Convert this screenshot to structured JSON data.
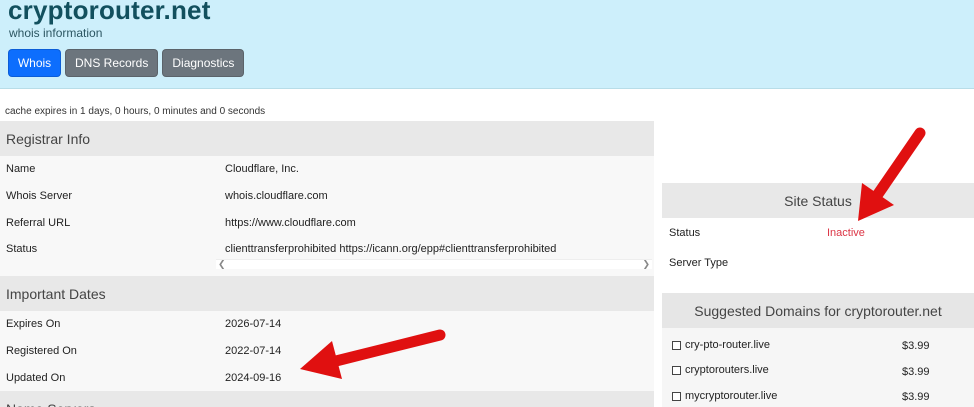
{
  "header": {
    "title": "cryptorouter.net",
    "subtitle": "whois information",
    "tabs": [
      {
        "label": "Whois",
        "active": true
      },
      {
        "label": "DNS Records",
        "active": false
      },
      {
        "label": "Diagnostics",
        "active": false
      }
    ]
  },
  "cache_text": "cache expires in 1 days, 0 hours, 0 minutes and 0 seconds",
  "registrar": {
    "heading": "Registrar Info",
    "rows": [
      {
        "label": "Name",
        "value": "Cloudflare, Inc."
      },
      {
        "label": "Whois Server",
        "value": "whois.cloudflare.com"
      },
      {
        "label": "Referral URL",
        "value": "https://www.cloudflare.com"
      },
      {
        "label": "Status",
        "value": "clienttransferprohibited https://icann.org/epp#clienttransferprohibited"
      }
    ]
  },
  "dates": {
    "heading": "Important Dates",
    "rows": [
      {
        "label": "Expires On",
        "value": "2026-07-14"
      },
      {
        "label": "Registered On",
        "value": "2022-07-14"
      },
      {
        "label": "Updated On",
        "value": "2024-09-16"
      }
    ]
  },
  "name_servers": {
    "heading": "Name Servers"
  },
  "site_status": {
    "heading": "Site Status",
    "status_label": "Status",
    "status_value": "Inactive",
    "server_type_label": "Server Type",
    "status_color": "#dc3545"
  },
  "suggested": {
    "heading": "Suggested Domains for cryptorouter.net",
    "items": [
      {
        "domain": "cry-pto-router.live",
        "price": "$3.99"
      },
      {
        "domain": "cryptorouters.live",
        "price": "$3.99"
      },
      {
        "domain": "mycryptorouter.live",
        "price": "$3.99"
      }
    ]
  },
  "colors": {
    "header_bg": "#cdeffb",
    "active_tab": "#0d6efd",
    "inactive_tab": "#6c757d",
    "annotation_arrow": "#e01010"
  }
}
